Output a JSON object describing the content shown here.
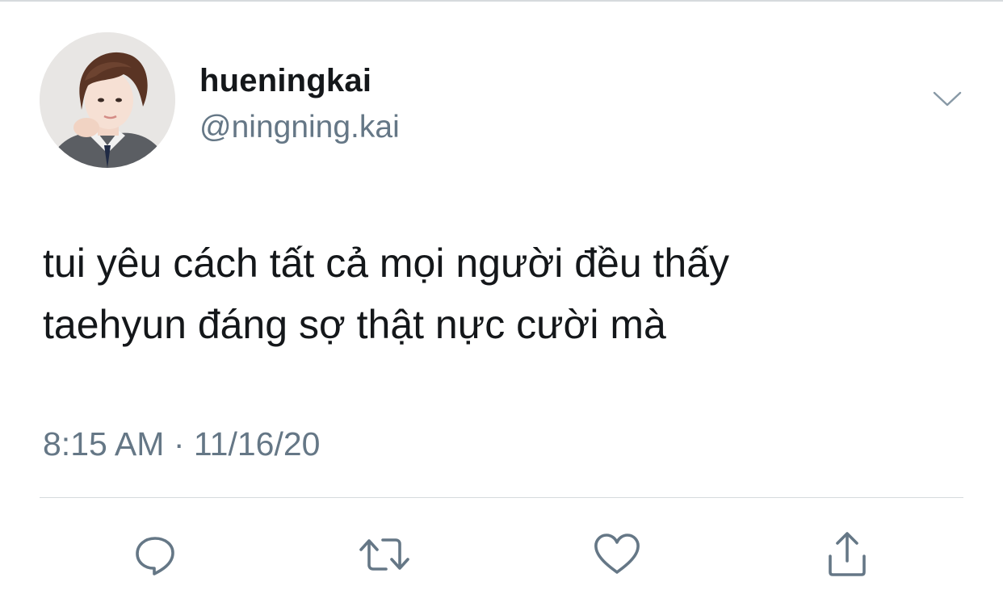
{
  "tweet": {
    "display_name": "hueningkai",
    "handle": "@ningning.kai",
    "text_line_1": "tui yêu cách tất cả mọi người đều thấy",
    "text_line_2": "taehyun đáng sợ thật nực cười mà",
    "time": "8:15 AM",
    "separator": "·",
    "date": "11/16/20"
  },
  "actions": [
    {
      "name": "reply",
      "icon": "speech-bubble-icon"
    },
    {
      "name": "retweet",
      "icon": "retweet-icon"
    },
    {
      "name": "like",
      "icon": "heart-icon"
    },
    {
      "name": "share",
      "icon": "share-icon"
    }
  ],
  "colors": {
    "text": "#14171a",
    "secondary_text": "#657786",
    "icon": "#657786",
    "divider": "#d6dadd",
    "background": "#ffffff"
  }
}
